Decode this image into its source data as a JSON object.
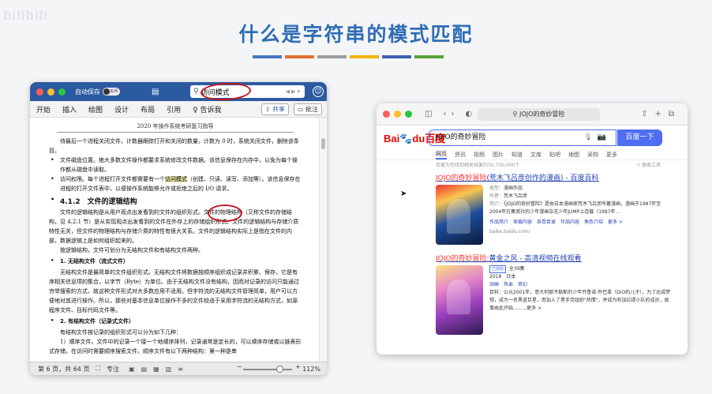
{
  "watermark": "bilibili",
  "slide": {
    "title": "什么是字符串的模式匹配",
    "bar_colors": [
      "#4a78c2",
      "#e0702f",
      "#9a9a9a",
      "#f2b400",
      "#3d62b3",
      "#5ba33a"
    ]
  },
  "word": {
    "autosave_label": "自动保存",
    "toggle_label": "关闭",
    "search_value": "访问模式",
    "tabs": [
      "开始",
      "插入",
      "绘图",
      "设计",
      "布局",
      "引用",
      "告诉我"
    ],
    "share_label": "共享",
    "comment_label": "批注",
    "doc": {
      "header": "2020 年操作系统考研复习指导",
      "lines": {
        "l1": "待最后一个进程关闭文件，计数器跟踪打开和关闭的数量，计数为 0 时，系统关闭文件，删除该条目。",
        "l2": "文件磁盘位置。绝大多数文件操作都要求系统修改文件数据。该信息保存在内存中，以免为每个操作都从磁盘中读取。",
        "l3_pre": "访问权限。每个进程打开文件都需要有一个",
        "l3_mark": "访问模式",
        "l3_post": "（创建、只读、读写、添加等）。该信息保存在进程的打开文件表中，以便操作系统能够允许或拒绝之后的 I/O 请求。",
        "h412": "4.1.2　文件的逻辑结构",
        "p1": "文件的逻辑结构是从用户观点出发看到的文件的组织形式。文件的物理结构（又称文件的存储结构，见 4.2.1 节）是从实现观点出发看到的文件在外存上的存储组织形式。文件的逻辑结构与存储介质特性无关，但文件的物理结构与存储介质的特性有很大关系。文件的逻辑结构实际上是指在文件的内部，数据逻辑上是如何组织起来的。",
        "p2": "按逻辑结构，文件可划分为无结构文件和有结构文件两种。",
        "s1": "1. 无结构文件（流式文件）",
        "p3": "无结构文件是最简单的文件组织形式。无结构文件将数据按顺序组织成记录并积累、保存，它是有序相关信息项的集合，以字节（Byte）为单位。由于无结构文件没有结构，因而对记录的访问只能通过穷举搜索的方式，故这种文件形式对大多数应用不适用。但字符流的无结构文件管理简单，用户可以方便地对其进行操作。所以，那些对基本信息单位操作不多的文件较适于采用字符流的无结构方式，如源程序文件、目标代码文件等。",
        "s2": "2. 有结构文件（记录式文件）",
        "p4": "有结构文件按记录的组织形式可以分为如下几种：",
        "p5": "1）顺序文件。文件中的记录一个接一个地顺序排列，记录通常是定长的，可以顺序存储或以链表形式存储，在访问时需要顺序搜索文件。顺序文件有以下两种结构：第一种是串"
      }
    },
    "status": {
      "page": "第 6 页，共 64 页",
      "focus": "专注",
      "zoom": "112%",
      "zoom_level_pct": 112
    }
  },
  "safari": {
    "url": "JOJO的奇妙冒险",
    "baidu": {
      "logo_a": "Bai",
      "logo_b": "du",
      "logo_c": "百度",
      "query": "JOJO的奇妙冒险",
      "button": "百度一下",
      "tabs": [
        "网页",
        "资讯",
        "视频",
        "图片",
        "知道",
        "文库",
        "贴吧",
        "地图",
        "采购",
        "更多"
      ],
      "count": "百度为您找到相关结果约30,700,000个",
      "tools": "搜索工具",
      "r1": {
        "title_em": "JOJO的奇妙冒险",
        "title_rest": "(荒木飞吕彦创作的漫画) - 百度百科",
        "type_k": "类型：",
        "type_v": "漫画作品",
        "author_k": "作者：",
        "author_v": "荒木飞吕彦",
        "intro_k": "简介：",
        "intro_v": "《JOJO的奇妙冒险》是由日本漫画家荒木飞吕彦所著漫画，漫画于1987年至2004年在集英社的少年漫画杂志少年JUMP上连载（1987年...",
        "links": "作品简介　体裁内容　各卷目录　作品内容　角色介绍　更多 >",
        "src": "baike.baidu.com/"
      },
      "r2": {
        "title_em": "JOJO的奇妙冒险",
        "title_rest": ":黄金之风 - 高清视频在线观看",
        "badge": "已完结",
        "eps": "全39集",
        "year": "2018　日本",
        "genre": "动画　热血　奇幻",
        "summary": "百科：公元2001年，意大利那不勒斯的少年乔鲁诺·乔巴拿（DIO的儿子），为了达成梦想，成为一名黑道巨星，而加入了黑手党组织\"热情\"，并成为布加拉提小队的成员，故事由此开始.........更多 >"
      }
    }
  }
}
